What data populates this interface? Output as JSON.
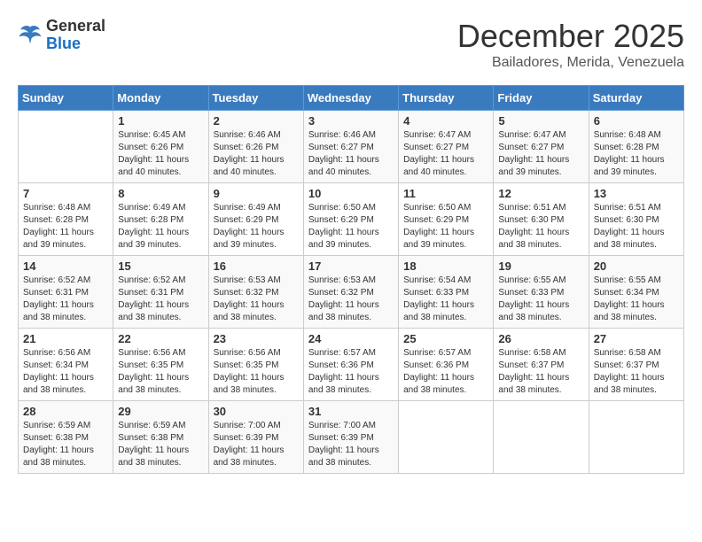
{
  "header": {
    "logo_general": "General",
    "logo_blue": "Blue",
    "month_title": "December 2025",
    "subtitle": "Bailadores, Merida, Venezuela"
  },
  "days_of_week": [
    "Sunday",
    "Monday",
    "Tuesday",
    "Wednesday",
    "Thursday",
    "Friday",
    "Saturday"
  ],
  "weeks": [
    [
      {
        "day": "",
        "lines": []
      },
      {
        "day": "1",
        "lines": [
          "Sunrise: 6:45 AM",
          "Sunset: 6:26 PM",
          "Daylight: 11 hours",
          "and 40 minutes."
        ]
      },
      {
        "day": "2",
        "lines": [
          "Sunrise: 6:46 AM",
          "Sunset: 6:26 PM",
          "Daylight: 11 hours",
          "and 40 minutes."
        ]
      },
      {
        "day": "3",
        "lines": [
          "Sunrise: 6:46 AM",
          "Sunset: 6:27 PM",
          "Daylight: 11 hours",
          "and 40 minutes."
        ]
      },
      {
        "day": "4",
        "lines": [
          "Sunrise: 6:47 AM",
          "Sunset: 6:27 PM",
          "Daylight: 11 hours",
          "and 40 minutes."
        ]
      },
      {
        "day": "5",
        "lines": [
          "Sunrise: 6:47 AM",
          "Sunset: 6:27 PM",
          "Daylight: 11 hours",
          "and 39 minutes."
        ]
      },
      {
        "day": "6",
        "lines": [
          "Sunrise: 6:48 AM",
          "Sunset: 6:28 PM",
          "Daylight: 11 hours",
          "and 39 minutes."
        ]
      }
    ],
    [
      {
        "day": "7",
        "lines": [
          "Sunrise: 6:48 AM",
          "Sunset: 6:28 PM",
          "Daylight: 11 hours",
          "and 39 minutes."
        ]
      },
      {
        "day": "8",
        "lines": [
          "Sunrise: 6:49 AM",
          "Sunset: 6:28 PM",
          "Daylight: 11 hours",
          "and 39 minutes."
        ]
      },
      {
        "day": "9",
        "lines": [
          "Sunrise: 6:49 AM",
          "Sunset: 6:29 PM",
          "Daylight: 11 hours",
          "and 39 minutes."
        ]
      },
      {
        "day": "10",
        "lines": [
          "Sunrise: 6:50 AM",
          "Sunset: 6:29 PM",
          "Daylight: 11 hours",
          "and 39 minutes."
        ]
      },
      {
        "day": "11",
        "lines": [
          "Sunrise: 6:50 AM",
          "Sunset: 6:29 PM",
          "Daylight: 11 hours",
          "and 39 minutes."
        ]
      },
      {
        "day": "12",
        "lines": [
          "Sunrise: 6:51 AM",
          "Sunset: 6:30 PM",
          "Daylight: 11 hours",
          "and 38 minutes."
        ]
      },
      {
        "day": "13",
        "lines": [
          "Sunrise: 6:51 AM",
          "Sunset: 6:30 PM",
          "Daylight: 11 hours",
          "and 38 minutes."
        ]
      }
    ],
    [
      {
        "day": "14",
        "lines": [
          "Sunrise: 6:52 AM",
          "Sunset: 6:31 PM",
          "Daylight: 11 hours",
          "and 38 minutes."
        ]
      },
      {
        "day": "15",
        "lines": [
          "Sunrise: 6:52 AM",
          "Sunset: 6:31 PM",
          "Daylight: 11 hours",
          "and 38 minutes."
        ]
      },
      {
        "day": "16",
        "lines": [
          "Sunrise: 6:53 AM",
          "Sunset: 6:32 PM",
          "Daylight: 11 hours",
          "and 38 minutes."
        ]
      },
      {
        "day": "17",
        "lines": [
          "Sunrise: 6:53 AM",
          "Sunset: 6:32 PM",
          "Daylight: 11 hours",
          "and 38 minutes."
        ]
      },
      {
        "day": "18",
        "lines": [
          "Sunrise: 6:54 AM",
          "Sunset: 6:33 PM",
          "Daylight: 11 hours",
          "and 38 minutes."
        ]
      },
      {
        "day": "19",
        "lines": [
          "Sunrise: 6:55 AM",
          "Sunset: 6:33 PM",
          "Daylight: 11 hours",
          "and 38 minutes."
        ]
      },
      {
        "day": "20",
        "lines": [
          "Sunrise: 6:55 AM",
          "Sunset: 6:34 PM",
          "Daylight: 11 hours",
          "and 38 minutes."
        ]
      }
    ],
    [
      {
        "day": "21",
        "lines": [
          "Sunrise: 6:56 AM",
          "Sunset: 6:34 PM",
          "Daylight: 11 hours",
          "and 38 minutes."
        ]
      },
      {
        "day": "22",
        "lines": [
          "Sunrise: 6:56 AM",
          "Sunset: 6:35 PM",
          "Daylight: 11 hours",
          "and 38 minutes."
        ]
      },
      {
        "day": "23",
        "lines": [
          "Sunrise: 6:56 AM",
          "Sunset: 6:35 PM",
          "Daylight: 11 hours",
          "and 38 minutes."
        ]
      },
      {
        "day": "24",
        "lines": [
          "Sunrise: 6:57 AM",
          "Sunset: 6:36 PM",
          "Daylight: 11 hours",
          "and 38 minutes."
        ]
      },
      {
        "day": "25",
        "lines": [
          "Sunrise: 6:57 AM",
          "Sunset: 6:36 PM",
          "Daylight: 11 hours",
          "and 38 minutes."
        ]
      },
      {
        "day": "26",
        "lines": [
          "Sunrise: 6:58 AM",
          "Sunset: 6:37 PM",
          "Daylight: 11 hours",
          "and 38 minutes."
        ]
      },
      {
        "day": "27",
        "lines": [
          "Sunrise: 6:58 AM",
          "Sunset: 6:37 PM",
          "Daylight: 11 hours",
          "and 38 minutes."
        ]
      }
    ],
    [
      {
        "day": "28",
        "lines": [
          "Sunrise: 6:59 AM",
          "Sunset: 6:38 PM",
          "Daylight: 11 hours",
          "and 38 minutes."
        ]
      },
      {
        "day": "29",
        "lines": [
          "Sunrise: 6:59 AM",
          "Sunset: 6:38 PM",
          "Daylight: 11 hours",
          "and 38 minutes."
        ]
      },
      {
        "day": "30",
        "lines": [
          "Sunrise: 7:00 AM",
          "Sunset: 6:39 PM",
          "Daylight: 11 hours",
          "and 38 minutes."
        ]
      },
      {
        "day": "31",
        "lines": [
          "Sunrise: 7:00 AM",
          "Sunset: 6:39 PM",
          "Daylight: 11 hours",
          "and 38 minutes."
        ]
      },
      {
        "day": "",
        "lines": []
      },
      {
        "day": "",
        "lines": []
      },
      {
        "day": "",
        "lines": []
      }
    ]
  ]
}
